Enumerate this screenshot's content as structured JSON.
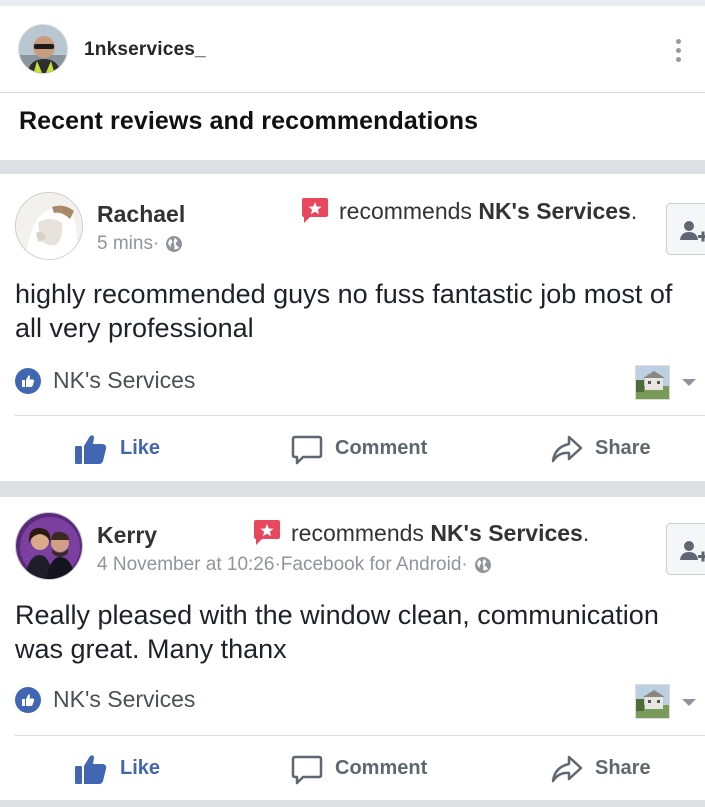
{
  "header": {
    "username": "1nkservices_"
  },
  "section": {
    "title": "Recent reviews and recommendations"
  },
  "reviews": [
    {
      "name": "Rachael",
      "recommends_prefix": "recommends ",
      "page_name": "NK's Services",
      "recommends_suffix": ".",
      "time": "5 mins",
      "source": "",
      "text": "highly recommended guys no fuss fantastic job most of all very professional",
      "page_tag": "NK's Services"
    },
    {
      "name": "Kerry",
      "recommends_prefix": "recommends ",
      "page_name": "NK's Services",
      "recommends_suffix": ".",
      "time": "4 November at 10:26",
      "source": "Facebook for Android",
      "text": "Really pleased with the window clean, communication was great. Many thanx",
      "page_tag": "NK's Services"
    }
  ],
  "actions": {
    "like": "Like",
    "comment": "Comment",
    "share": "Share"
  },
  "separator": " · ",
  "colors": {
    "facebook_blue": "#4267b2",
    "recommend_red": "#e9475e",
    "meta_gray": "#90949c"
  }
}
